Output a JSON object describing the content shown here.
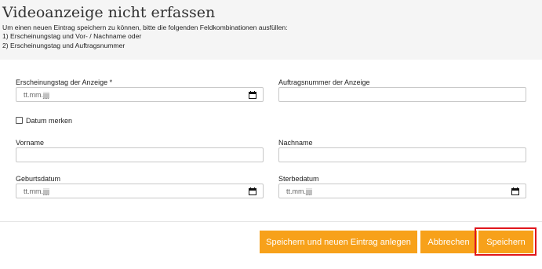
{
  "header": {
    "title": "Videoanzeige nicht erfassen",
    "hint_line1": "Um einen neuen Eintrag speichern zu können, bitte die folgenden Feldkombinationen ausfüllen:",
    "hint_line2": "1) Erscheinungstag und Vor- / Nachname oder",
    "hint_line3": "2) Erscheinungstag und Auftragsnummer"
  },
  "form": {
    "erscheinungstag": {
      "label": "Erscheinungstag der Anzeige *",
      "placeholder": "tt.mm.jjjj",
      "icon": "calendar-icon"
    },
    "auftragsnummer": {
      "label": "Auftragsnummer der Anzeige",
      "value": ""
    },
    "datum_merken": {
      "label": "Datum merken",
      "checked": false
    },
    "vorname": {
      "label": "Vorname",
      "value": ""
    },
    "nachname": {
      "label": "Nachname",
      "value": ""
    },
    "geburtsdatum": {
      "label": "Geburtsdatum",
      "placeholder": "tt.mm.jjjj",
      "icon": "calendar-icon"
    },
    "sterbedatum": {
      "label": "Sterbedatum",
      "placeholder": "tt.mm.jjjj",
      "icon": "calendar-icon"
    }
  },
  "actions": {
    "save_and_new_label": "Speichern und neuen Eintrag anlegen",
    "cancel_label": "Abbrechen",
    "save_label": "Speichern",
    "highlighted": "save_label"
  },
  "colors": {
    "button_bg": "#f7a11a",
    "button_text": "#ffffff",
    "highlight_border": "#e0161c",
    "header_bg": "#f5f5f5"
  }
}
